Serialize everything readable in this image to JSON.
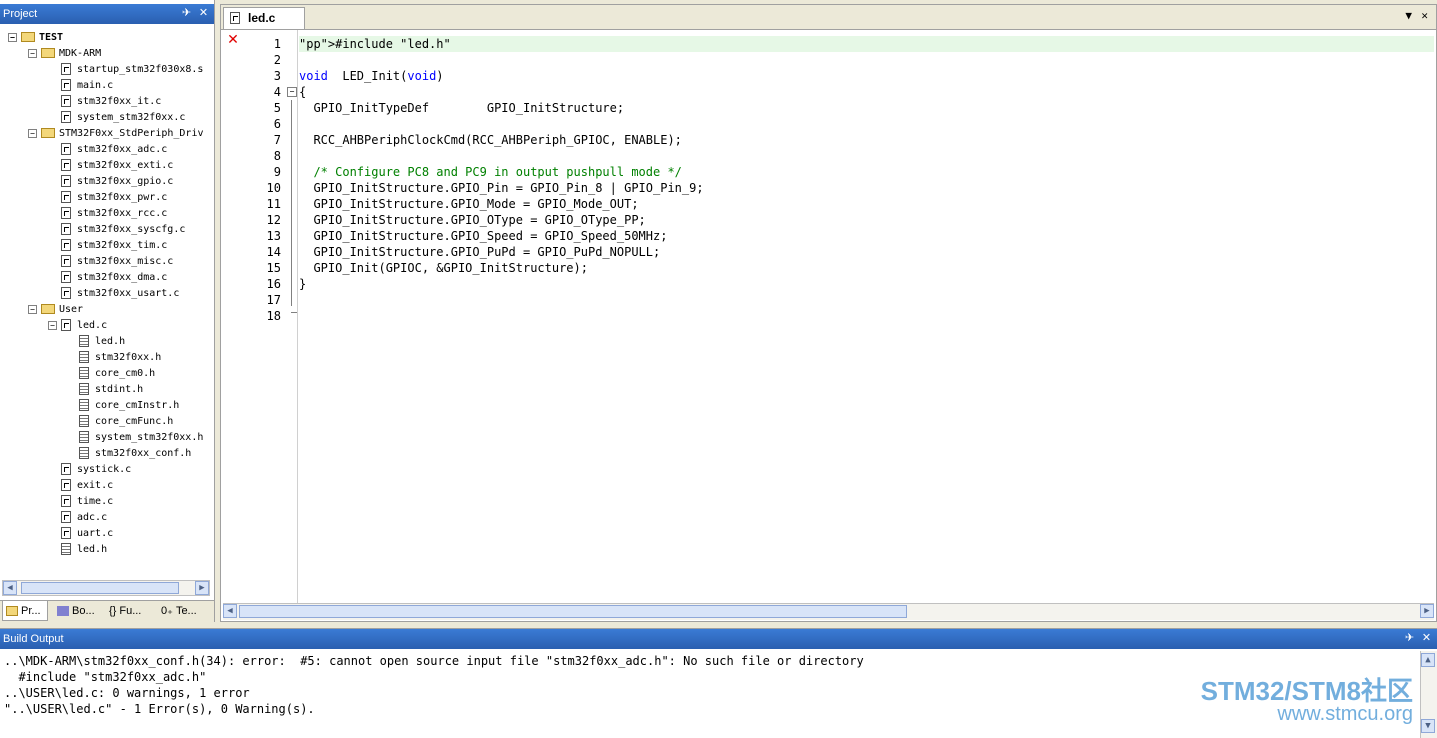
{
  "project_panel": {
    "title": "Project",
    "tree": [
      {
        "label": "TEST",
        "type": "root",
        "depth": 0
      },
      {
        "label": "MDK-ARM",
        "type": "folder",
        "depth": 1
      },
      {
        "label": "startup_stm32f030x8.s",
        "type": "c",
        "depth": 2
      },
      {
        "label": "main.c",
        "type": "c",
        "depth": 2
      },
      {
        "label": "stm32f0xx_it.c",
        "type": "c",
        "depth": 2
      },
      {
        "label": "system_stm32f0xx.c",
        "type": "c",
        "depth": 2
      },
      {
        "label": "STM32F0xx_StdPeriph_Driv",
        "type": "folder",
        "depth": 1
      },
      {
        "label": "stm32f0xx_adc.c",
        "type": "c",
        "depth": 2
      },
      {
        "label": "stm32f0xx_exti.c",
        "type": "c",
        "depth": 2
      },
      {
        "label": "stm32f0xx_gpio.c",
        "type": "c",
        "depth": 2
      },
      {
        "label": "stm32f0xx_pwr.c",
        "type": "c",
        "depth": 2
      },
      {
        "label": "stm32f0xx_rcc.c",
        "type": "c",
        "depth": 2
      },
      {
        "label": "stm32f0xx_syscfg.c",
        "type": "c",
        "depth": 2
      },
      {
        "label": "stm32f0xx_tim.c",
        "type": "c",
        "depth": 2
      },
      {
        "label": "stm32f0xx_misc.c",
        "type": "c",
        "depth": 2
      },
      {
        "label": "stm32f0xx_dma.c",
        "type": "c",
        "depth": 2
      },
      {
        "label": "stm32f0xx_usart.c",
        "type": "c",
        "depth": 2
      },
      {
        "label": "User",
        "type": "folder",
        "depth": 1
      },
      {
        "label": "led.c",
        "type": "c",
        "depth": 2,
        "expanded": true
      },
      {
        "label": "led.h",
        "type": "h",
        "depth": 3
      },
      {
        "label": "stm32f0xx.h",
        "type": "h",
        "depth": 3
      },
      {
        "label": "core_cm0.h",
        "type": "h",
        "depth": 3
      },
      {
        "label": "stdint.h",
        "type": "h",
        "depth": 3
      },
      {
        "label": "core_cmInstr.h",
        "type": "h",
        "depth": 3
      },
      {
        "label": "core_cmFunc.h",
        "type": "h",
        "depth": 3
      },
      {
        "label": "system_stm32f0xx.h",
        "type": "h",
        "depth": 3
      },
      {
        "label": "stm32f0xx_conf.h",
        "type": "h",
        "depth": 3
      },
      {
        "label": "systick.c",
        "type": "c",
        "depth": 2
      },
      {
        "label": "exit.c",
        "type": "c",
        "depth": 2
      },
      {
        "label": "time.c",
        "type": "c",
        "depth": 2
      },
      {
        "label": "adc.c",
        "type": "c",
        "depth": 2
      },
      {
        "label": "uart.c",
        "type": "c",
        "depth": 2
      },
      {
        "label": "led.h",
        "type": "h",
        "depth": 2
      }
    ],
    "bottom_tabs": [
      "Pr...",
      "Bo...",
      "Fu...",
      "Te..."
    ]
  },
  "editor": {
    "tab_label": "led.c",
    "lines": [
      "#include \"led.h\"",
      "",
      "void  LED_Init(void)",
      "{",
      "  GPIO_InitTypeDef        GPIO_InitStructure;",
      "",
      "  RCC_AHBPeriphClockCmd(RCC_AHBPeriph_GPIOC, ENABLE);",
      "",
      "  /* Configure PC8 and PC9 in output pushpull mode */",
      "  GPIO_InitStructure.GPIO_Pin = GPIO_Pin_8 | GPIO_Pin_9;",
      "  GPIO_InitStructure.GPIO_Mode = GPIO_Mode_OUT;",
      "  GPIO_InitStructure.GPIO_OType = GPIO_OType_PP;",
      "  GPIO_InitStructure.GPIO_Speed = GPIO_Speed_50MHz;",
      "  GPIO_InitStructure.GPIO_PuPd = GPIO_PuPd_NOPULL;",
      "  GPIO_Init(GPIOC, &GPIO_InitStructure);",
      "}",
      "",
      ""
    ],
    "error_line": 1
  },
  "build_output": {
    "title": "Build Output",
    "lines": [
      "..\\MDK-ARM\\stm32f0xx_conf.h(34): error:  #5: cannot open source input file \"stm32f0xx_adc.h\": No such file or directory",
      "  #include \"stm32f0xx_adc.h\"",
      "..\\USER\\led.c: 0 warnings, 1 error",
      "\"..\\USER\\led.c\" - 1 Error(s), 0 Warning(s)."
    ]
  },
  "watermark": {
    "line1": "STM32/STM8社区",
    "line2": "www.stmcu.org"
  },
  "colors": {
    "keyword": "#0000ff",
    "comment": "#008000",
    "error": "#e00000",
    "titlebar": "#3a7bd5"
  }
}
